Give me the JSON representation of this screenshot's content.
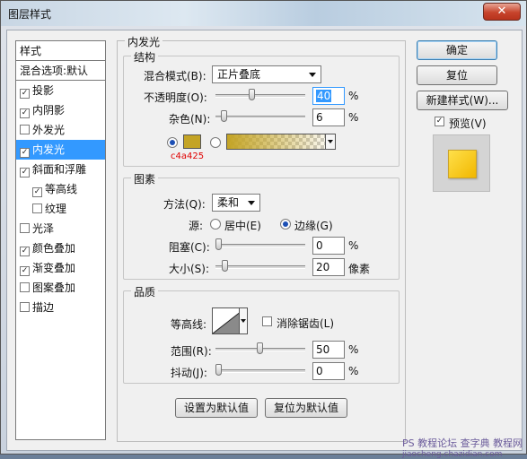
{
  "window": {
    "title": "图层样式",
    "close_glyph": "✕"
  },
  "styles_list": [
    {
      "label": "样式",
      "checkbox": false,
      "checked": false,
      "selected": false,
      "indent": false,
      "header": true
    },
    {
      "label": "混合选项:默认",
      "checkbox": false,
      "checked": false,
      "selected": false,
      "indent": false,
      "header": true
    },
    {
      "label": "投影",
      "checkbox": true,
      "checked": true,
      "selected": false,
      "indent": false
    },
    {
      "label": "内阴影",
      "checkbox": true,
      "checked": true,
      "selected": false,
      "indent": false
    },
    {
      "label": "外发光",
      "checkbox": true,
      "checked": false,
      "selected": false,
      "indent": false
    },
    {
      "label": "内发光",
      "checkbox": true,
      "checked": true,
      "selected": true,
      "indent": false
    },
    {
      "label": "斜面和浮雕",
      "checkbox": true,
      "checked": true,
      "selected": false,
      "indent": false
    },
    {
      "label": "等高线",
      "checkbox": true,
      "checked": true,
      "selected": false,
      "indent": true
    },
    {
      "label": "纹理",
      "checkbox": true,
      "checked": false,
      "selected": false,
      "indent": true
    },
    {
      "label": "光泽",
      "checkbox": true,
      "checked": false,
      "selected": false,
      "indent": false
    },
    {
      "label": "颜色叠加",
      "checkbox": true,
      "checked": true,
      "selected": false,
      "indent": false
    },
    {
      "label": "渐变叠加",
      "checkbox": true,
      "checked": true,
      "selected": false,
      "indent": false
    },
    {
      "label": "图案叠加",
      "checkbox": true,
      "checked": false,
      "selected": false,
      "indent": false
    },
    {
      "label": "描边",
      "checkbox": true,
      "checked": false,
      "selected": false,
      "indent": false
    }
  ],
  "panel": {
    "title": "内发光",
    "structure": {
      "label": "结构",
      "blend_mode_label": "混合模式(B):",
      "blend_mode_value": "正片叠底",
      "opacity_label": "不透明度(O):",
      "opacity_value": "40",
      "opacity_level": 0.4,
      "noise_label": "杂色(N):",
      "noise_value": "6",
      "noise_level": 0.06,
      "percent": "%",
      "color_hex": "#c4a425",
      "color_annotation": "c4a425"
    },
    "elements": {
      "label": "图素",
      "method_label": "方法(Q):",
      "method_value": "柔和",
      "source_label": "源:",
      "source_center": "居中(E)",
      "source_edge": "边缘(G)",
      "choke_label": "阻塞(C):",
      "choke_value": "0",
      "choke_level": 0,
      "size_label": "大小(S):",
      "size_value": "20",
      "size_level": 0.08,
      "size_unit": "像素"
    },
    "quality": {
      "label": "品质",
      "contour_label": "等高线:",
      "antialias_label": "消除锯齿(L)",
      "range_label": "范围(R):",
      "range_value": "50",
      "range_level": 0.5,
      "jitter_label": "抖动(J):",
      "jitter_value": "0",
      "jitter_level": 0
    },
    "set_default": "设置为默认值",
    "reset_default": "复位为默认值"
  },
  "buttons": {
    "ok": "确定",
    "reset": "复位",
    "new_style": "新建样式(W)...",
    "preview_label": "预览(V)"
  },
  "watermark": {
    "left": "PS",
    "middle": "教程论坛",
    "right": "查字典 教程网",
    "url": "jiaocheng.chazidian.com"
  }
}
